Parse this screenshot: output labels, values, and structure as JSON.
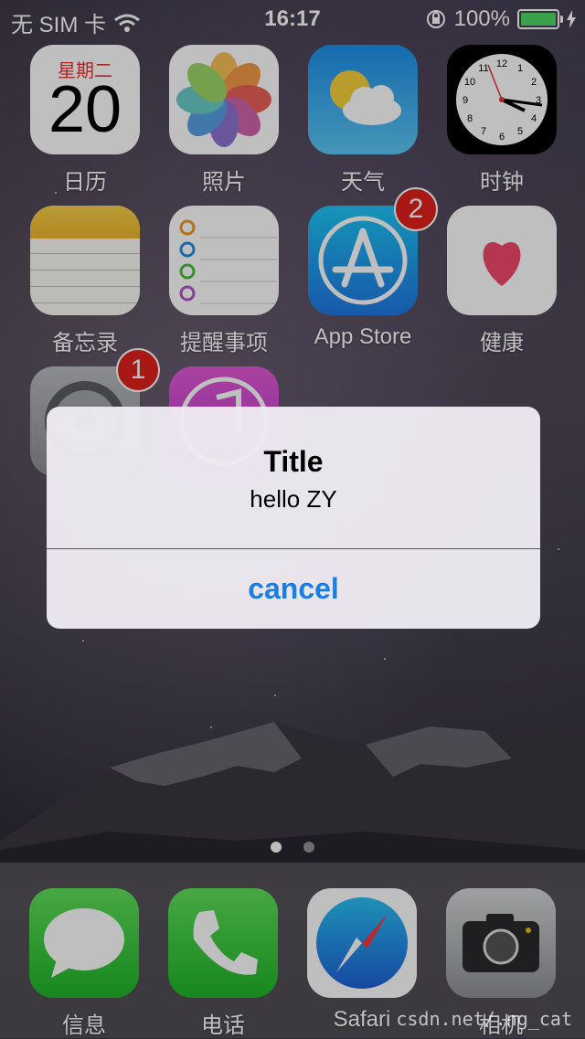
{
  "status_bar": {
    "carrier": "无 SIM 卡",
    "time": "16:17",
    "battery": "100%"
  },
  "home_apps": [
    {
      "label": "日历",
      "icon": "calendar-icon",
      "weekday": "星期二",
      "day": "20"
    },
    {
      "label": "照片",
      "icon": "photos-icon"
    },
    {
      "label": "天气",
      "icon": "weather-icon"
    },
    {
      "label": "时钟",
      "icon": "clock-icon"
    },
    {
      "label": "备忘录",
      "icon": "notes-icon"
    },
    {
      "label": "提醒事项",
      "icon": "reminders-icon"
    },
    {
      "label": "App Store",
      "icon": "app-store-icon",
      "badge": "2"
    },
    {
      "label": "健康",
      "icon": "health-icon"
    },
    {
      "label": "",
      "icon": "settings-icon",
      "badge": "1"
    },
    {
      "label": "",
      "icon": "itunes-store-icon"
    }
  ],
  "alert": {
    "title": "Title",
    "message": "hello ZY",
    "cancel_label": "cancel",
    "button_color": "#1a7fe0"
  },
  "page_dots": {
    "count": 2,
    "active": 0
  },
  "dock_apps": [
    {
      "label": "信息",
      "icon": "messages-icon"
    },
    {
      "label": "电话",
      "icon": "phone-icon"
    },
    {
      "label": "Safari",
      "icon": "safari-icon"
    },
    {
      "label": "相机",
      "icon": "camera-icon"
    }
  ],
  "watermark": "csdn.net/.ng_cat"
}
